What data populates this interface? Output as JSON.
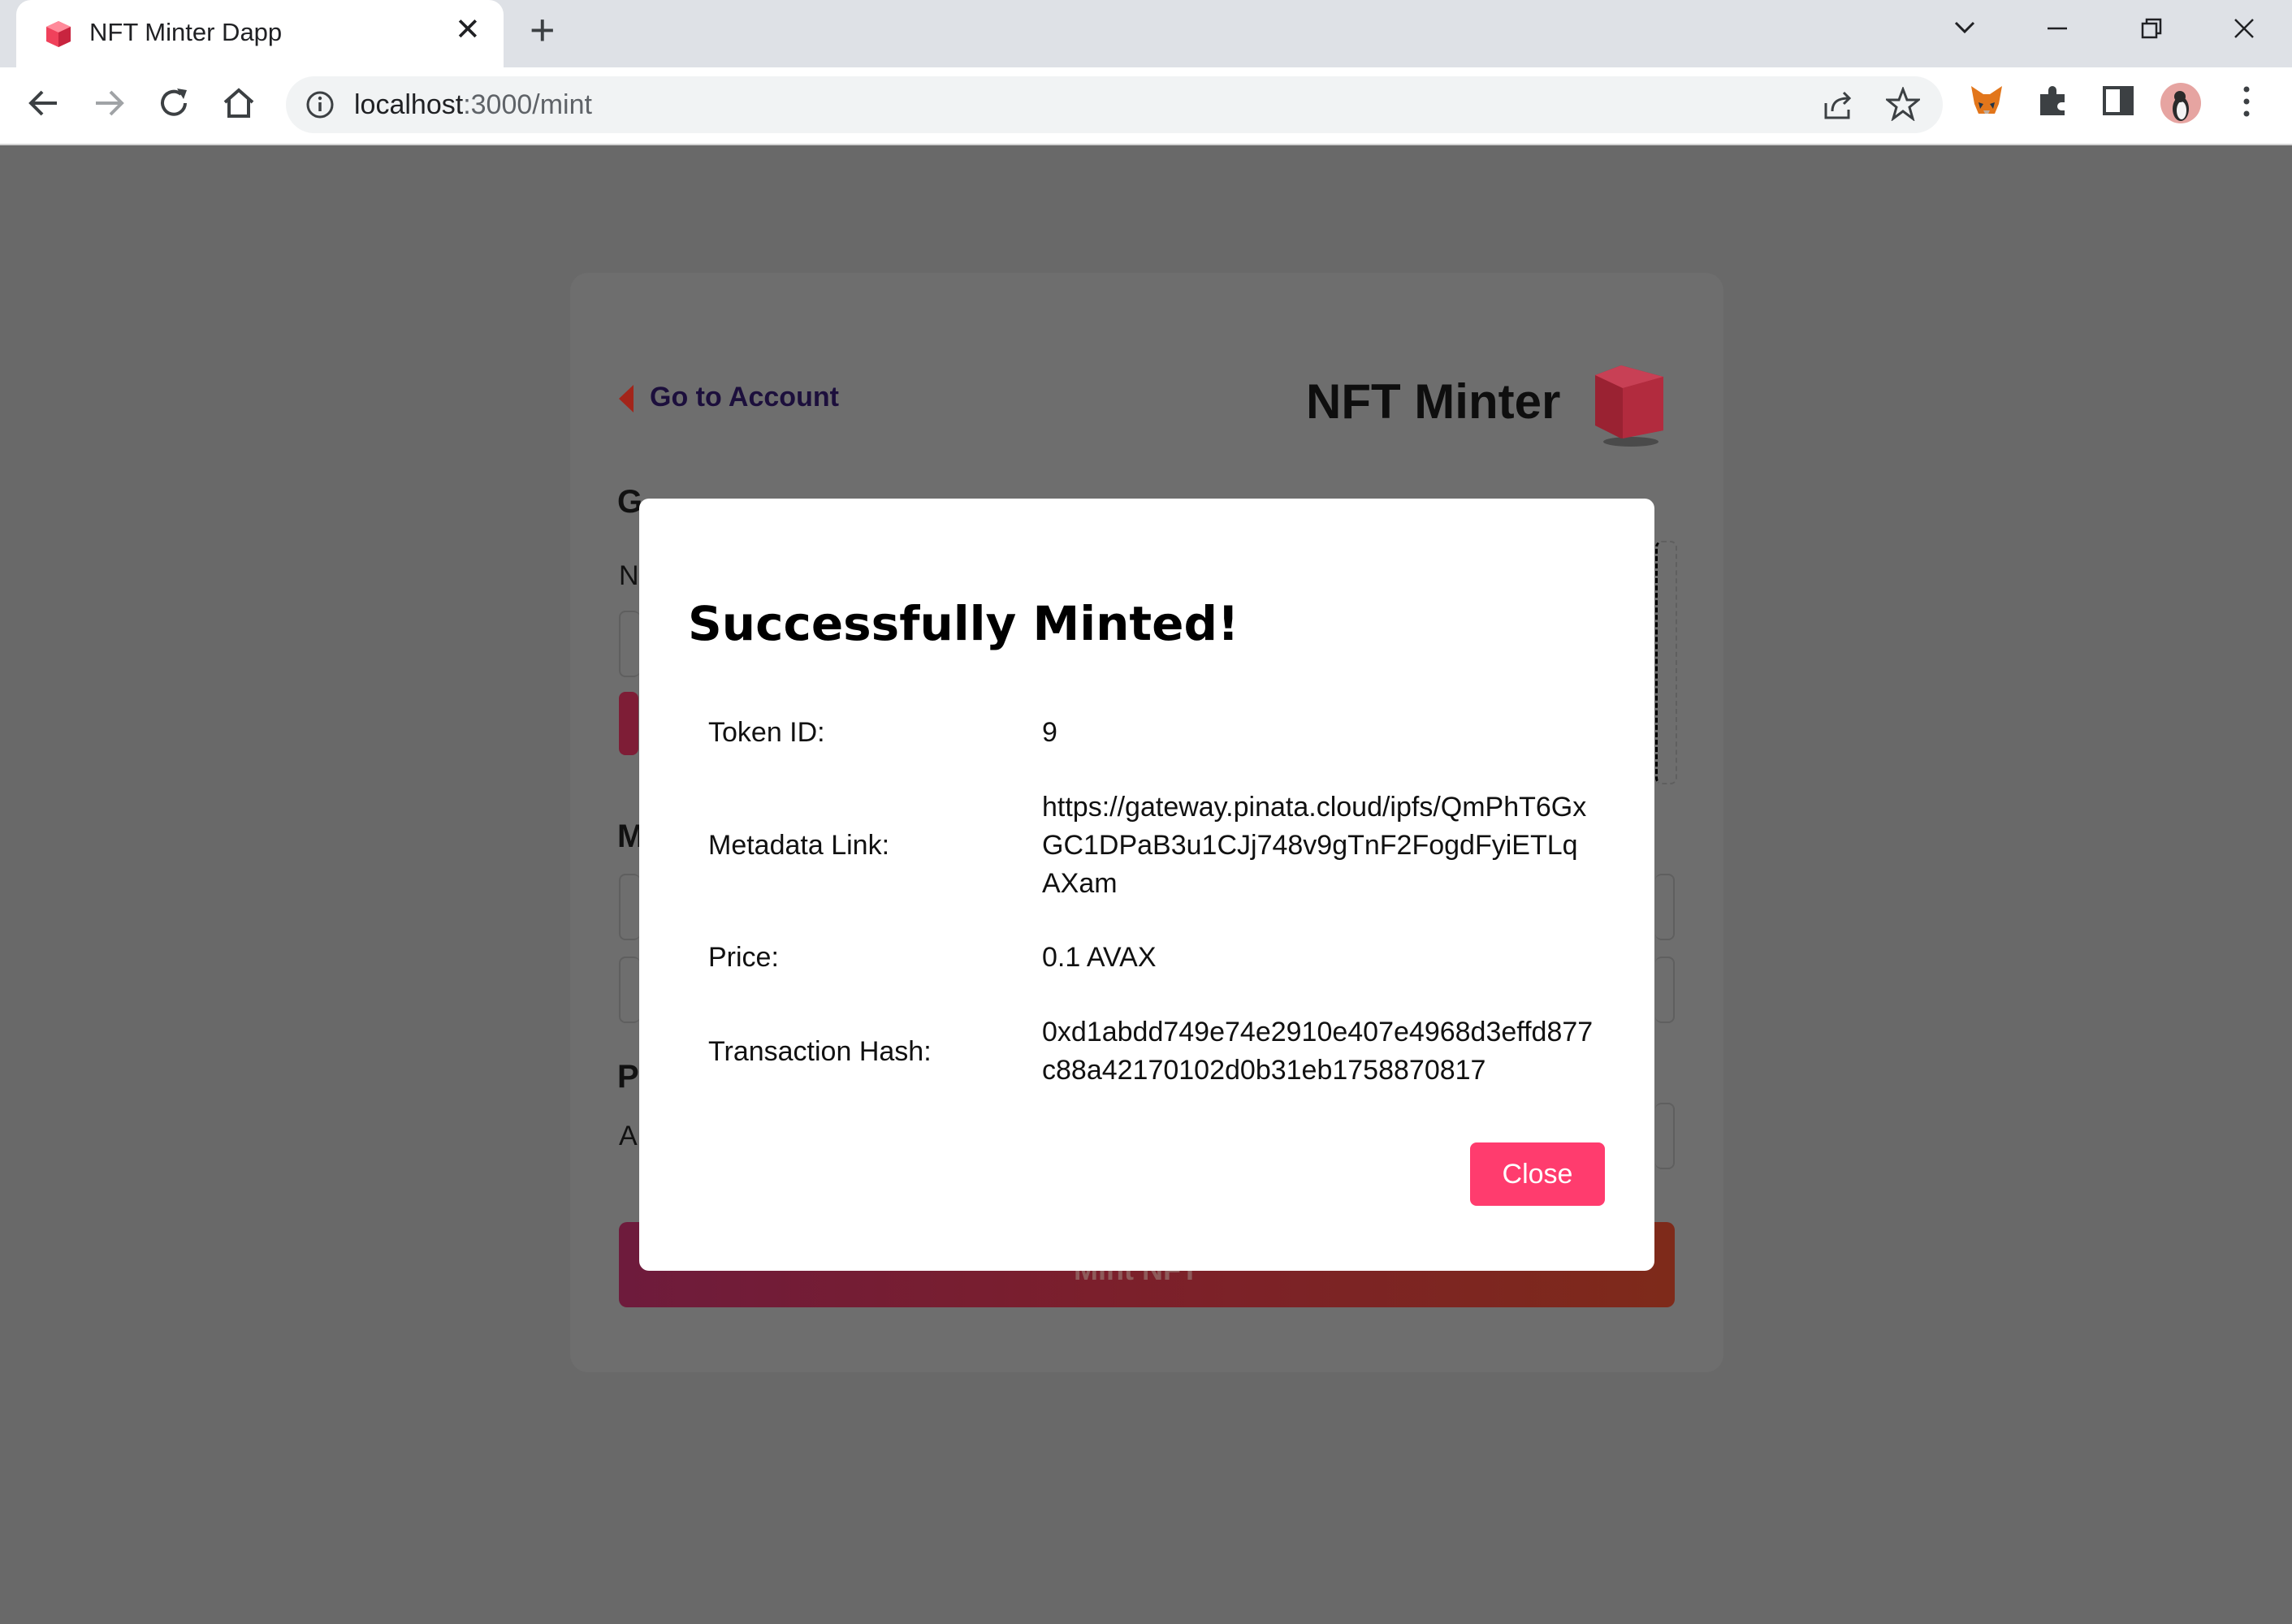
{
  "browser": {
    "tab_title": "NFT Minter Dapp",
    "url_host": "localhost",
    "url_path": ":3000/mint"
  },
  "page": {
    "back_link": "Go to Account",
    "brand_title": "NFT Minter",
    "mint_button": "Mint NFT"
  },
  "modal": {
    "title": "Successfully Minted!",
    "rows": [
      {
        "label": "Token ID:",
        "value": "9"
      },
      {
        "label": "Metadata Link:",
        "value": "https://gateway.pinata.cloud/ipfs/QmPhT6GxGC1DPaB3u1CJj748v9gTnF2FogdFyiETLqAXam"
      },
      {
        "label": "Price:",
        "value": "0.1 AVAX"
      },
      {
        "label": "Transaction Hash:",
        "value": "0xd1abdd749e74e2910e407e4968d3effd877c88a42170102d0b31eb1758870817"
      }
    ],
    "close_label": "Close"
  },
  "icons": {
    "favicon": "cube-icon",
    "accent": "#ff3c6e"
  }
}
